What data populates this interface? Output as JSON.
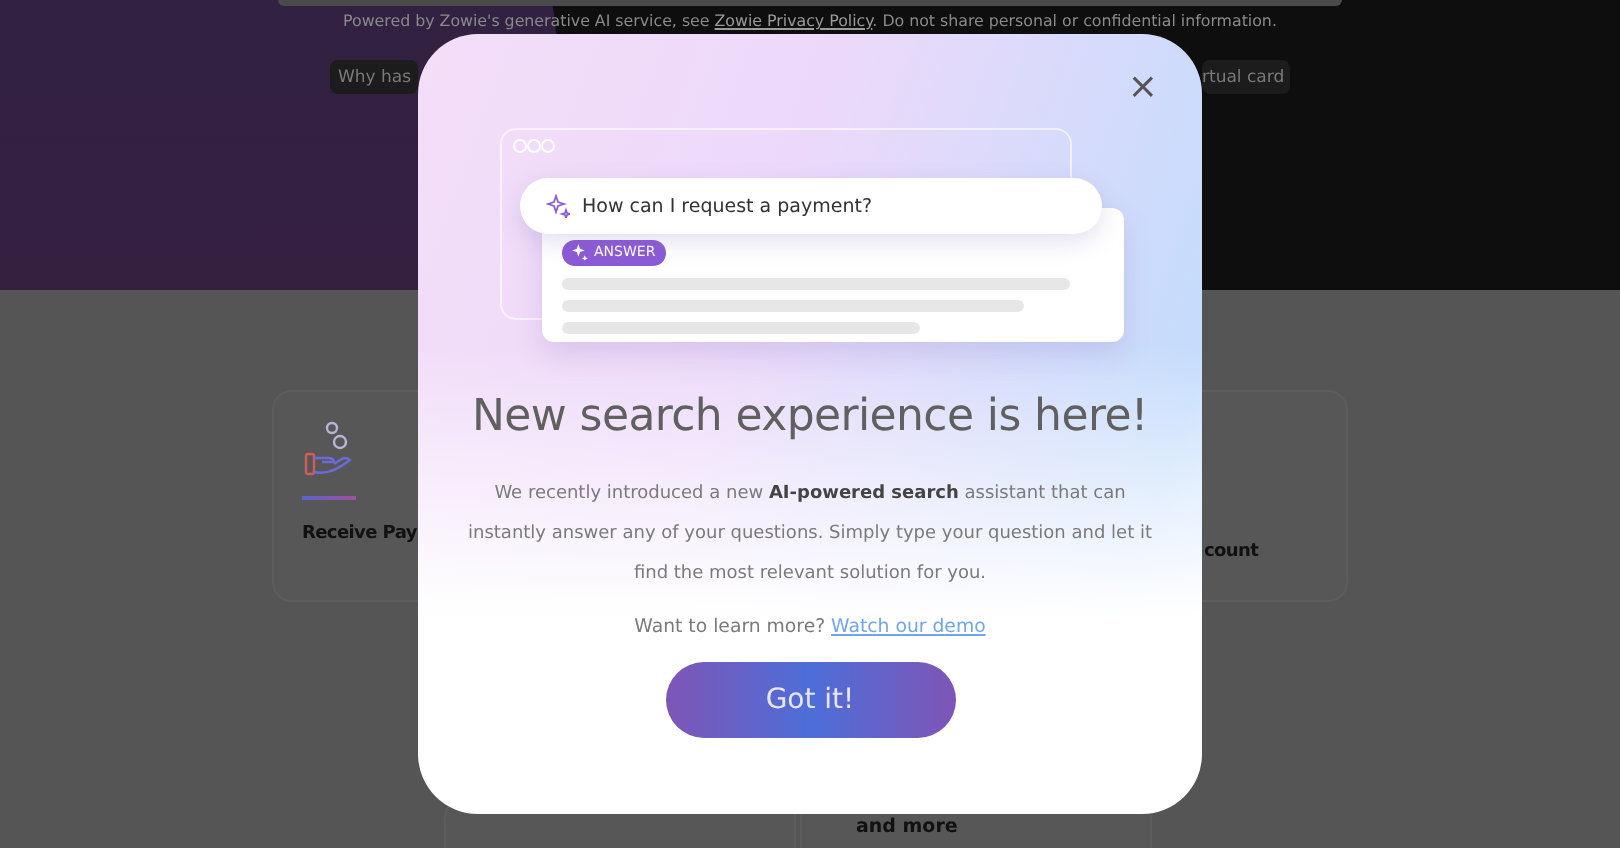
{
  "background": {
    "disclaimer": {
      "before": "Powered by Zowie's generative AI service, see",
      "link": "Zowie Privacy Policy",
      "after": ". Do not share personal or confidential information."
    },
    "suggestions": [
      "Why has",
      "rtual card"
    ],
    "cards": [
      {
        "title": "Receive Pay"
      },
      {
        "title": "count"
      }
    ],
    "lower_card_text": "and more"
  },
  "modal": {
    "close": "×",
    "illustration": {
      "question": "How can I request a payment?",
      "badge": "ANSWER"
    },
    "title": "New search experience is here!",
    "body": "We recently introduced a new **AI-powered search** assistant that can instantly answer any of your questions. Simply type your question and let it find the most relevant solution for you.",
    "learn_more": {
      "text": "Want to learn more?",
      "link": "Watch our demo"
    },
    "button": "Got it!"
  }
}
